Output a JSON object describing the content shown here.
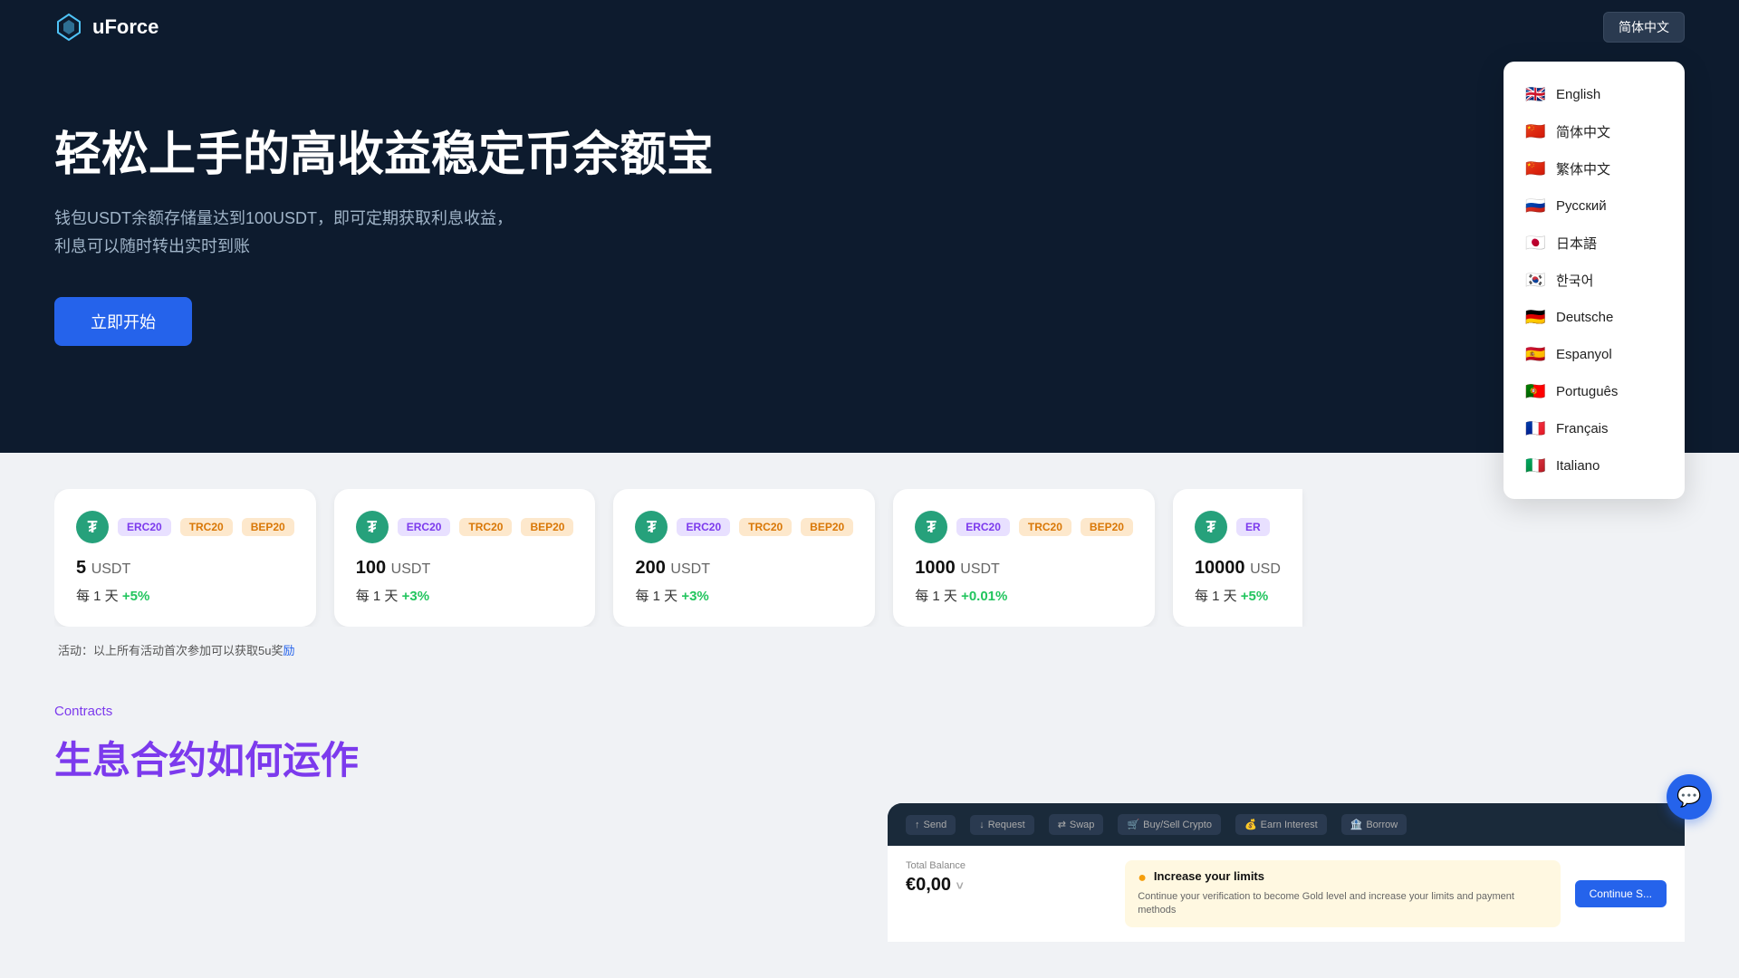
{
  "header": {
    "logo_text": "uForce",
    "lang_button_label": "简体中文"
  },
  "lang_dropdown": {
    "items": [
      {
        "flag": "🇬🇧",
        "label": "English"
      },
      {
        "flag": "🇨🇳",
        "label": "简体中文"
      },
      {
        "flag": "🇨🇳",
        "label": "繁体中文"
      },
      {
        "flag": "🇷🇺",
        "label": "Русский"
      },
      {
        "flag": "🇯🇵",
        "label": "日本語"
      },
      {
        "flag": "🇰🇷",
        "label": "한국어"
      },
      {
        "flag": "🇩🇪",
        "label": "Deutsche"
      },
      {
        "flag": "🇪🇸",
        "label": "Espanyol"
      },
      {
        "flag": "🇵🇹",
        "label": "Português"
      },
      {
        "flag": "🇫🇷",
        "label": "Français"
      },
      {
        "flag": "🇮🇹",
        "label": "Italiano"
      }
    ]
  },
  "hero": {
    "title": "轻松上手的高收益稳定币余额宝",
    "description_line1": "钱包USDT余额存储量达到100USDT，即可定期获取利息收益，",
    "description_line2": "利息可以随时转出实时到账",
    "cta_button": "立即开始"
  },
  "cards": [
    {
      "amount": "5",
      "unit": "USDT",
      "period": "每 1 天",
      "rate": "+5%",
      "badges": [
        "ERC20",
        "TRC20",
        "BEP20"
      ]
    },
    {
      "amount": "100",
      "unit": "USDT",
      "period": "每 1 天",
      "rate": "+3%",
      "badges": [
        "ERC20",
        "TRC20",
        "BEP20"
      ]
    },
    {
      "amount": "200",
      "unit": "USDT",
      "period": "每 1 天",
      "rate": "+3%",
      "badges": [
        "ERC20",
        "TRC20",
        "BEP20"
      ]
    },
    {
      "amount": "1000",
      "unit": "USDT",
      "period": "每 1 天",
      "rate": "+0.01%",
      "badges": [
        "ERC20",
        "TRC20",
        "BEP20"
      ]
    },
    {
      "amount": "10000",
      "unit": "USD",
      "period": "每 1 天",
      "rate": "+5%",
      "badges": [
        "ER"
      ]
    }
  ],
  "activity": {
    "text_before": "活动：以上所有活动首次参加可以获取5u奖",
    "link_text": "励",
    "text_after": ""
  },
  "contracts": {
    "label": "Contracts",
    "title": "生息合约如何运作"
  },
  "mockup": {
    "buttons": [
      "Send",
      "Request",
      "Swap",
      "Buy/Sell Crypto",
      "Earn Interest",
      "Borrow"
    ],
    "balance_label": "Total Balance",
    "balance_value": "€0,00",
    "upgrade_title": "Increase your limits",
    "upgrade_desc": "Continue your verification to become Gold level and increase your limits and payment methods",
    "continue_btn": "Continue S..."
  },
  "chat": {
    "icon": "💬"
  }
}
